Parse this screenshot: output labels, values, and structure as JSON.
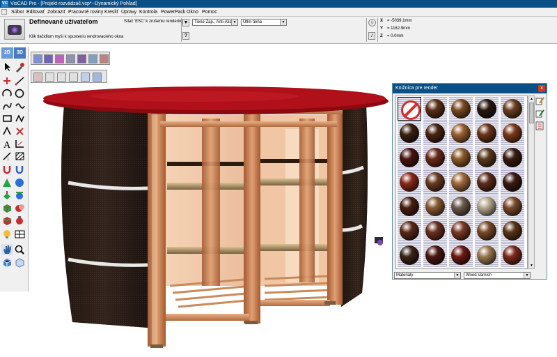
{
  "titlebar": {
    "app_icon": "VC",
    "title": "VisCAD Pro - [Projekt rozvádzač.vcp*--Dynamický Pohľad]"
  },
  "menubar": {
    "items": [
      "Súbor",
      "Editovať",
      "Zobraziť",
      "Pracovné roviny",
      "Kresliť",
      "Úpravy",
      "Kontrola",
      "PowerPack",
      "Okno",
      "Pomoc"
    ]
  },
  "context": {
    "title": "Definované užívateľom",
    "hint": "Klik tlačidlom myši k spusteniu rendrovacieho okna",
    "esc_hint": "Stlač 'ESC' k zrušeniu renderingu",
    "shadows_combo": "Tiene Zap., Anti-Alia",
    "shading_combo": "Utlm tieňa",
    "help_button": "?",
    "info_button": "i"
  },
  "coords": {
    "x_label": "X",
    "x_value": "= -5039.1mm",
    "y_label": "Y",
    "y_value": "= 1162.9mm",
    "z_label": "Z",
    "z_value": "= 0.0mm"
  },
  "left_toolbar": {
    "view_2d": "2D",
    "view_3d": "3D"
  },
  "library": {
    "title": "Knižnica pre render",
    "close": "x",
    "category_combo": "Materiály",
    "material_combo": "Wood Varnish",
    "swatches": [
      "none",
      "#5a3018",
      "#7a4a22",
      "#2a1810",
      "#6a4020",
      "#3a2010",
      "#4a2414",
      "#9a6030",
      "#6a3418",
      "#7a3a1c",
      "#4a1410",
      "#6a2a18",
      "#8a5a2a",
      "#5a3a1c",
      "#3a1c10",
      "#8a2a18",
      "#6a3a22",
      "#a06a3a",
      "#5a2c18",
      "#3a1a12",
      "#4a1e10",
      "#8a5a34",
      "#6a5a4a",
      "#b8a890",
      "#7a4a2a",
      "#5a2a18",
      "#6a3020",
      "#7a3a26",
      "#7a4a2a",
      "#5a3418",
      "#3a2418",
      "#4a1812",
      "#6a1a14",
      "#9a7a52",
      "#7a2a1c",
      "#2a0c0a",
      "#7a1a14",
      "#9a8a70",
      "#c0a070",
      "#5a1a12",
      "#3a2018",
      "#7a3a1e",
      "#4a2414",
      "#6a2a10",
      "#8a1a10"
    ]
  },
  "colors": {
    "titlebar": "#0b4f87",
    "tabletop": "#a80c14",
    "wood": "#c77a4a",
    "panel": "#2b1d16"
  }
}
